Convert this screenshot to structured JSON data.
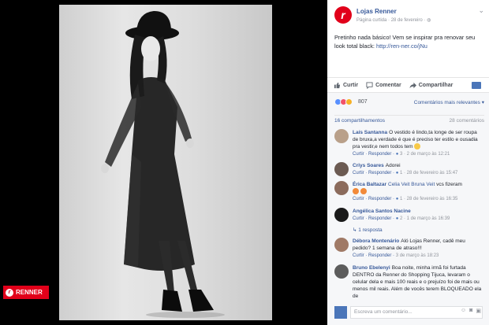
{
  "photo": {
    "badge_text": "RENNER"
  },
  "post": {
    "page_name": "Lojas Renner",
    "meta": "Página curtida · 28 de fevereiro · ",
    "text_main": "Pretinho nada básico! Vem se inspirar pra renovar seu look total black: ",
    "text_link": "http://ren-ner.co/jNu",
    "avatar_letter": "r"
  },
  "actions": {
    "like": "Curtir",
    "comment": "Comentar",
    "share": "Compartilhar"
  },
  "reactions": {
    "count": "807",
    "sort_label": "Comentários mais relevantes ▾",
    "shares": "16 compartilhamentos",
    "comments": "28 comentários"
  },
  "comments": [
    {
      "name": "Laís Santanna",
      "text": "O vestido é lindo,ta longe de ser roupa de bruxa,a verdade é que é preciso ter estilo e ousadia pra vestir,e nem todos tem",
      "actions": "Curtir · Responder · ",
      "likes": "3",
      "time": " · 2 de março às 12:21"
    },
    {
      "name": "Criys Soares",
      "text": "Adorei",
      "actions": "Curtir · Responder · ",
      "likes": "",
      "time": "1 · 28 de fevereiro às 15:47"
    },
    {
      "name": "Érica Baltazar",
      "tags": "Celia Veit Bruna Veit",
      "text": " vcs fizeram",
      "actions": "Curtir · Responder · ",
      "likes": "",
      "time": "1 · 28 de fevereiro às 16:35"
    },
    {
      "name": "Angélica Santos Nacine",
      "text": "",
      "actions": "Curtir · Responder · ",
      "likes": "2",
      "time": " · 1 de março às 16:39"
    },
    {
      "name": "Débora Montenário",
      "text": "Aló Lojas Renner, cadê meu pedido? 1 semana de atraso!!!",
      "actions": "Curtir · Responder · ",
      "likes": "",
      "time": "3 de março às 18:23"
    },
    {
      "name": "Bruno Ebelenyi",
      "text": "Boa noite, minha irmã foi furtada DENTRO da Renner do Shopping Tijuca, levaram o celular dela e mais 100 reais e o prejuízo foi de mais ou menos mil reais. Além de vocês terem BLOQUEADO ela de",
      "actions": "",
      "likes": "",
      "time": ""
    }
  ],
  "reply_link": "1 resposta",
  "write": {
    "placeholder": "Escreva um comentário..."
  },
  "colors": {
    "link": "#365899",
    "brand_red": "#e1001a",
    "muted": "#90949c"
  }
}
